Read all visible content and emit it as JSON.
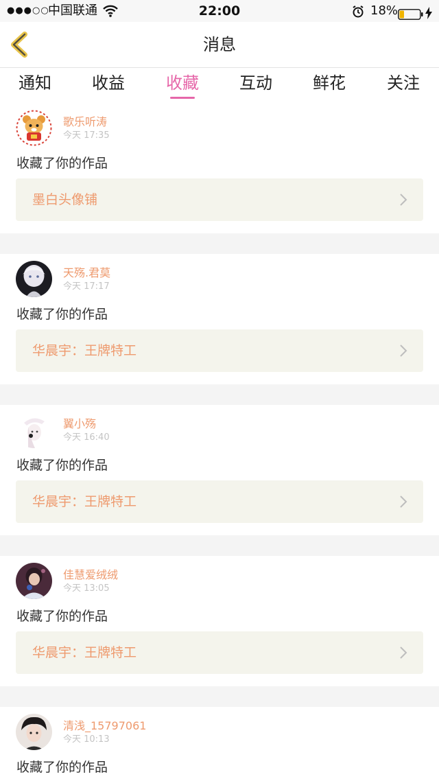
{
  "status_bar": {
    "signal": "●●●○○",
    "carrier": "中国联通",
    "time": "22:00",
    "battery": "18%"
  },
  "header": {
    "title": "消息"
  },
  "tabs": [
    {
      "label": "通知",
      "active": false
    },
    {
      "label": "收益",
      "active": false
    },
    {
      "label": "收藏",
      "active": true
    },
    {
      "label": "互动",
      "active": false
    },
    {
      "label": "鲜花",
      "active": false
    },
    {
      "label": "关注",
      "active": false
    }
  ],
  "colors": {
    "accent": "#e667a9",
    "name": "#ee9a6e",
    "card_bg": "#f4f4ec",
    "back_icon": "#e8c44a"
  },
  "messages": [
    {
      "user": "歌乐听涛",
      "time": "今天 17:35",
      "action": "收藏了你的作品",
      "work": "墨白头像铺"
    },
    {
      "user": "天殇.君莫",
      "time": "今天 17:17",
      "action": "收藏了你的作品",
      "work": "华晨宇：王牌特工"
    },
    {
      "user": "翼小殇",
      "time": "今天 16:40",
      "action": "收藏了你的作品",
      "work": "华晨宇：王牌特工"
    },
    {
      "user": "佳慧爱绒绒",
      "time": "今天 13:05",
      "action": "收藏了你的作品",
      "work": "华晨宇：王牌特工"
    },
    {
      "user": "清浅_15797061",
      "time": "今天 10:13",
      "action": "收藏了你的作品",
      "work": ""
    }
  ]
}
